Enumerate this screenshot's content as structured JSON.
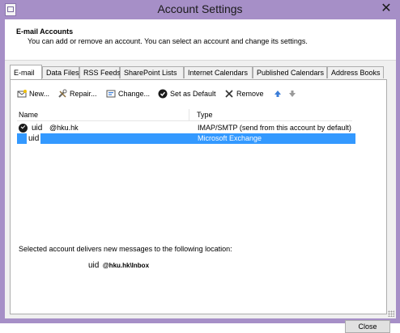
{
  "window": {
    "title": "Account Settings",
    "close_glyph": "✕"
  },
  "header": {
    "title": "E-mail Accounts",
    "description": "You can add or remove an account. You can select an account and change its settings."
  },
  "tabs": [
    {
      "label": "E-mail",
      "active": true
    },
    {
      "label": "Data Files"
    },
    {
      "label": "RSS Feeds"
    },
    {
      "label": "SharePoint Lists"
    },
    {
      "label": "Internet Calendars"
    },
    {
      "label": "Published Calendars"
    },
    {
      "label": "Address Books"
    }
  ],
  "toolbar": {
    "new_label": "New...",
    "repair_label": "Repair...",
    "change_label": "Change...",
    "set_default_label": "Set as Default",
    "remove_label": "Remove"
  },
  "accounts": {
    "col_name": "Name",
    "col_type": "Type",
    "rows": [
      {
        "name": "uid",
        "email": "@hku.hk",
        "type": "IMAP/SMTP (send from this account by default)",
        "default": true
      },
      {
        "name": "uid",
        "type": "Microsoft Exchange",
        "selected": true
      }
    ]
  },
  "delivery": {
    "text": "Selected account delivers new messages to the following location:",
    "location_user": "uid",
    "location_path": "@hku.hk\\Inbox"
  },
  "footer": {
    "close_label": "Close"
  },
  "colors": {
    "titlebar": "#a68fc7",
    "selection": "#3399ff"
  }
}
